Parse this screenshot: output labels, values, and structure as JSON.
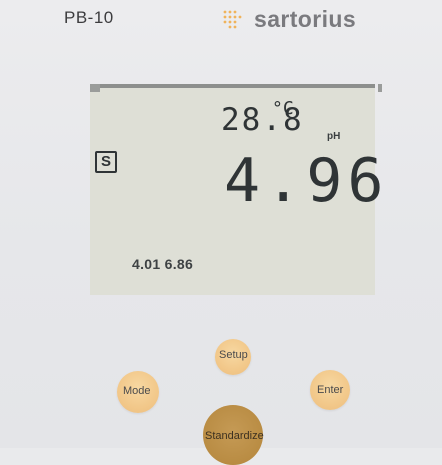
{
  "header": {
    "model": "PB-10",
    "brand": "sartorius"
  },
  "display": {
    "temperature": "28.8",
    "temperature_unit": "°C",
    "unit": "pH",
    "main_value": "4.96",
    "stability_symbol": "S",
    "buffer_set": "4.01 6.86"
  },
  "buttons": {
    "setup": "Setup",
    "mode": "Mode",
    "enter": "Enter",
    "standardize": "Standardize"
  },
  "colors": {
    "button": "#f2c88a",
    "standardize": "#b98c43",
    "lcd": "#dedfd6",
    "brand": "#7a7a7e"
  }
}
